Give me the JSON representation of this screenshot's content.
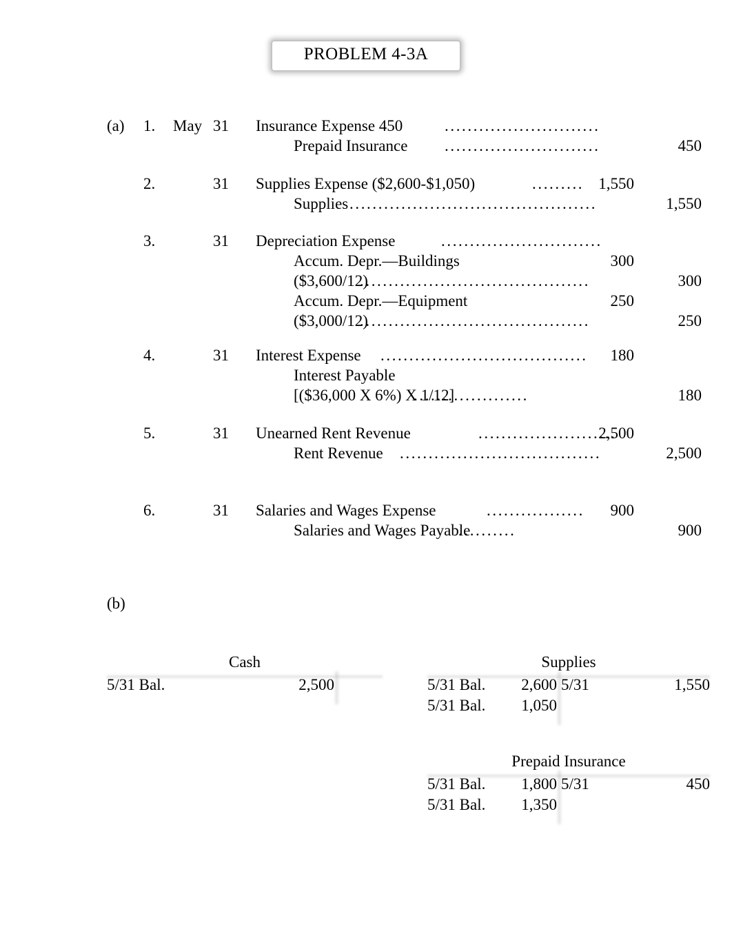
{
  "document": {
    "title": "PROBLEM 4-3A"
  },
  "part_a": {
    "label": "(a)",
    "entries": [
      {
        "number": "1.",
        "month": "May",
        "day": "31",
        "lines": [
          {
            "account": "Insurance Expense 450",
            "leader": "...........................",
            "debit": "",
            "credit": ""
          },
          {
            "account": "Prepaid Insurance",
            "leader": "...........................",
            "debit": "",
            "credit": "450",
            "indent": true
          }
        ]
      },
      {
        "number": "2.",
        "month": "",
        "day": "31",
        "lines": [
          {
            "account": "Supplies Expense ($2,600-$1,050)",
            "leader": ".........",
            "debit": "1,550",
            "credit": ""
          },
          {
            "account": "Supplies",
            "leader": "...........................................",
            "debit": "",
            "credit": "1,550",
            "indent": true
          }
        ]
      },
      {
        "number": "3.",
        "month": "",
        "day": "31",
        "lines": [
          {
            "account": "Depreciation Expense",
            "leader": "............................",
            "debit": "",
            "credit": ""
          },
          {
            "account": "Accum. Depr.—Buildings",
            "leader": "",
            "debit": "300",
            "credit": "",
            "indent": true
          },
          {
            "account": "($3,600/12)",
            "leader": "........................................",
            "debit": "",
            "credit": "300",
            "indent": true
          },
          {
            "account": "Accum. Depr.—Equipment",
            "leader": "",
            "debit": "250",
            "credit": "",
            "indent": true
          },
          {
            "account": "($3,000/12)",
            "leader": "........................................",
            "debit": "",
            "credit": "250",
            "indent": true
          }
        ]
      },
      {
        "number": "4.",
        "month": "",
        "day": "31",
        "lines": [
          {
            "account": "Interest Expense",
            "leader": "....................................",
            "debit": "180",
            "credit": ""
          },
          {
            "account": "Interest Payable",
            "leader": "",
            "debit": "",
            "credit": "",
            "indent": true
          },
          {
            "account": "[($36,000 X 6%) X 1/12]",
            "leader": "....................",
            "debit": "",
            "credit": "180",
            "indent": true
          }
        ]
      },
      {
        "number": "5.",
        "month": "",
        "day": "31",
        "lines": [
          {
            "account": "Unearned Rent Revenue",
            "leader": "........................",
            "debit": "2,500",
            "credit": ""
          },
          {
            "account": "Rent Revenue",
            "leader": "...................................",
            "debit": "",
            "credit": "2,500",
            "indent": true
          }
        ]
      },
      {
        "number": "6.",
        "month": "",
        "day": "31",
        "lines": [
          {
            "account": "Salaries and Wages Expense",
            "leader": ".................",
            "debit": "900",
            "credit": ""
          },
          {
            "account": "Salaries and Wages Payable",
            "leader": "..........",
            "debit": "",
            "credit": "900",
            "indent": true
          }
        ]
      }
    ]
  },
  "part_b": {
    "label": "(b)",
    "accounts": [
      {
        "name": "Cash",
        "rows": [
          {
            "debit_label": "5/31 Bal.",
            "debit_amount": "2,500",
            "credit_label": "",
            "credit_amount": ""
          }
        ]
      },
      {
        "name": "Supplies",
        "rows": [
          {
            "debit_label": "5/31 Bal.",
            "debit_amount": "2,600",
            "credit_label": "5/31",
            "credit_amount": "1,550"
          },
          {
            "debit_label": "5/31 Bal.",
            "debit_amount": "1,050",
            "credit_label": "",
            "credit_amount": ""
          }
        ]
      },
      {
        "name": "Prepaid Insurance",
        "rows": [
          {
            "debit_label": "5/31 Bal.",
            "debit_amount": "1,800",
            "credit_label": "5/31",
            "credit_amount": "450"
          },
          {
            "debit_label": "5/31 Bal.",
            "debit_amount": "1,350",
            "credit_label": "",
            "credit_amount": ""
          }
        ]
      }
    ]
  }
}
